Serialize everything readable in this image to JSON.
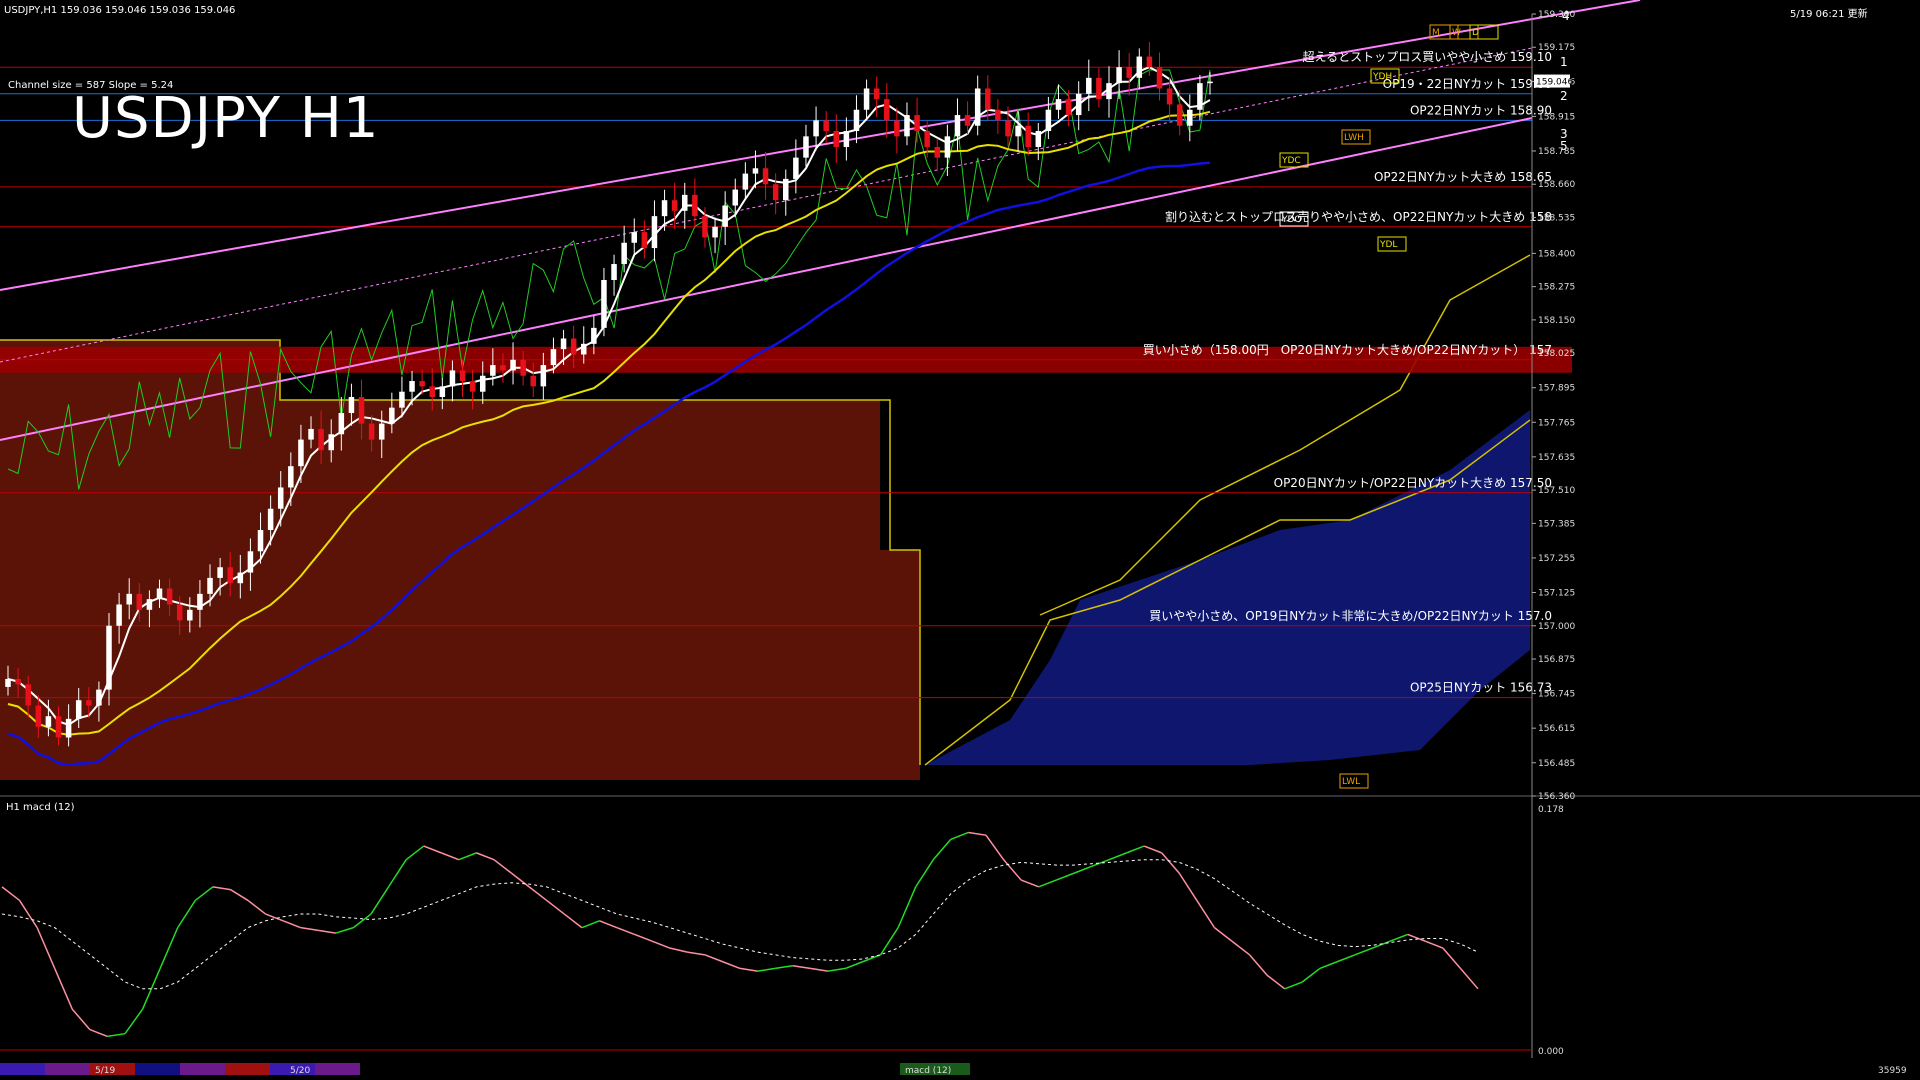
{
  "header": {
    "info": "USDJPY,H1  159.036 159.046 159.036 159.046",
    "datetime": "5/19 06:21 更新",
    "channel": "Channel size = 587  Slope = 5.24",
    "macd_label": "H1  macd (12)",
    "title": "USDJPY H1"
  },
  "colors": {
    "background": "#000000",
    "bull_candle": "#ffffff",
    "bear_candle": "#e8101a",
    "ma_short": "#ffffff",
    "ma_mid": "#e8e000",
    "ma_long": "#1010e0",
    "rsi": "#22cc22",
    "channel": "#ff80ff",
    "level_line": "#c00000",
    "cloud_red": "#7a1a0a",
    "cloud_blue": "#101a80",
    "macd_up": "#22dd22",
    "macd_down": "#ff8fa0",
    "signal": "#ffffff"
  },
  "chart_data": [
    {
      "type": "candlestick",
      "title": "USDJPY H1",
      "ylim": [
        156.36,
        159.3
      ],
      "yticks": [
        159.3,
        159.175,
        159.046,
        158.915,
        158.785,
        158.66,
        158.535,
        158.4,
        158.275,
        158.15,
        158.025,
        157.895,
        157.765,
        157.635,
        157.51,
        157.385,
        157.255,
        157.125,
        157.0,
        156.875,
        156.745,
        156.615,
        156.485,
        156.36
      ],
      "current_price": 159.046,
      "close_series": [
        156.8,
        156.78,
        156.7,
        156.62,
        156.66,
        156.58,
        156.65,
        156.72,
        156.7,
        156.76,
        157.0,
        157.08,
        157.12,
        157.06,
        157.1,
        157.14,
        157.08,
        157.02,
        157.06,
        157.12,
        157.18,
        157.22,
        157.16,
        157.2,
        157.28,
        157.36,
        157.44,
        157.52,
        157.6,
        157.7,
        157.74,
        157.66,
        157.72,
        157.8,
        157.86,
        157.76,
        157.7,
        157.76,
        157.82,
        157.88,
        157.92,
        157.9,
        157.86,
        157.9,
        157.96,
        157.92,
        157.88,
        157.94,
        157.98,
        157.96,
        158.0,
        157.94,
        157.9,
        157.98,
        158.04,
        158.08,
        158.02,
        158.06,
        158.12,
        158.3,
        158.36,
        158.44,
        158.48,
        158.42,
        158.54,
        158.6,
        158.56,
        158.62,
        158.54,
        158.46,
        158.5,
        158.58,
        158.64,
        158.7,
        158.72,
        158.66,
        158.6,
        158.68,
        158.76,
        158.84,
        158.9,
        158.86,
        158.8,
        158.86,
        158.94,
        159.02,
        158.98,
        158.9,
        158.84,
        158.92,
        158.86,
        158.8,
        158.76,
        158.84,
        158.92,
        158.88,
        159.02,
        158.94,
        158.9,
        158.84,
        158.88,
        158.8,
        158.86,
        158.94,
        158.98,
        158.92,
        159.0,
        159.06,
        158.98,
        159.04,
        159.1,
        159.06,
        159.14,
        159.1,
        159.02,
        158.96,
        158.88,
        158.94,
        159.04,
        159.046
      ],
      "levels": [
        {
          "price": 159.1,
          "label": "超えるとストップロス買いやや小さめ 159.10",
          "color": "#c00000"
        },
        {
          "price": 159.0,
          "label": "OP19・22日NYカット 159.00",
          "color": "#1a6fd6"
        },
        {
          "price": 158.9,
          "label": "OP22日NYカット 158.90",
          "color": "#1a6fd6"
        },
        {
          "price": 158.65,
          "label": "OP22日NYカット大きめ 158.65",
          "color": "#c00000"
        },
        {
          "price": 158.5,
          "label": "割り込むとストップロス売りやや小さめ、OP22日NYカット大きめ 158",
          "color": "#c00000"
        },
        {
          "price": 158.0,
          "label": "買い小さめ（158.00円　OP20日NYカット大きめ/OP22日NYカット） 157",
          "color": "#c00000",
          "band": true
        },
        {
          "price": 157.5,
          "label": "OP20日NYカット/OP22日NYカット大きめ 157.50",
          "color": "#c00000"
        },
        {
          "price": 157.0,
          "label": "買いやや小さめ、OP19日NYカット非常に大きめ/OP22日NYカット 157.0",
          "color": "#c00000"
        },
        {
          "price": 156.73,
          "label": "OP25日NYカット 156.73",
          "color": "#c00000"
        }
      ],
      "pivot_labels": [
        "1",
        "2",
        "3",
        "4",
        "5"
      ],
      "tags": [
        "YDH",
        "YDC",
        "YDO",
        "YDL",
        "LWH",
        "LWL",
        "M",
        "W",
        "D"
      ]
    },
    {
      "type": "line",
      "title": "H1  macd (12)",
      "ylim": [
        0.0,
        0.178
      ],
      "yticks": [
        0.178,
        0.0
      ],
      "macd": [
        0.12,
        0.11,
        0.09,
        0.06,
        0.03,
        0.015,
        0.01,
        0.012,
        0.03,
        0.06,
        0.09,
        0.11,
        0.12,
        0.118,
        0.11,
        0.1,
        0.095,
        0.09,
        0.088,
        0.086,
        0.09,
        0.1,
        0.12,
        0.14,
        0.15,
        0.145,
        0.14,
        0.145,
        0.14,
        0.13,
        0.12,
        0.11,
        0.1,
        0.09,
        0.095,
        0.09,
        0.085,
        0.08,
        0.075,
        0.072,
        0.07,
        0.065,
        0.06,
        0.058,
        0.06,
        0.062,
        0.06,
        0.058,
        0.06,
        0.065,
        0.07,
        0.09,
        0.12,
        0.14,
        0.155,
        0.16,
        0.158,
        0.14,
        0.125,
        0.12,
        0.125,
        0.13,
        0.135,
        0.14,
        0.145,
        0.15,
        0.145,
        0.13,
        0.11,
        0.09,
        0.08,
        0.07,
        0.055,
        0.045,
        0.05,
        0.06,
        0.065,
        0.07,
        0.075,
        0.08,
        0.085,
        0.08,
        0.075,
        0.06,
        0.045
      ],
      "signal": [
        0.1,
        0.098,
        0.095,
        0.09,
        0.08,
        0.07,
        0.06,
        0.05,
        0.045,
        0.045,
        0.05,
        0.06,
        0.07,
        0.08,
        0.09,
        0.095,
        0.098,
        0.1,
        0.1,
        0.098,
        0.097,
        0.096,
        0.097,
        0.1,
        0.105,
        0.11,
        0.115,
        0.12,
        0.122,
        0.123,
        0.122,
        0.12,
        0.115,
        0.11,
        0.105,
        0.1,
        0.097,
        0.094,
        0.09,
        0.086,
        0.082,
        0.078,
        0.075,
        0.072,
        0.07,
        0.068,
        0.067,
        0.066,
        0.066,
        0.067,
        0.07,
        0.075,
        0.085,
        0.1,
        0.115,
        0.125,
        0.132,
        0.136,
        0.138,
        0.137,
        0.136,
        0.136,
        0.137,
        0.138,
        0.139,
        0.14,
        0.14,
        0.138,
        0.133,
        0.126,
        0.117,
        0.108,
        0.1,
        0.092,
        0.085,
        0.08,
        0.077,
        0.076,
        0.077,
        0.079,
        0.081,
        0.082,
        0.082,
        0.078,
        0.072
      ]
    }
  ],
  "footer": {
    "dates": [
      "5/19",
      "5/20"
    ],
    "macd_tab": "macd (12)",
    "count": "35959"
  }
}
